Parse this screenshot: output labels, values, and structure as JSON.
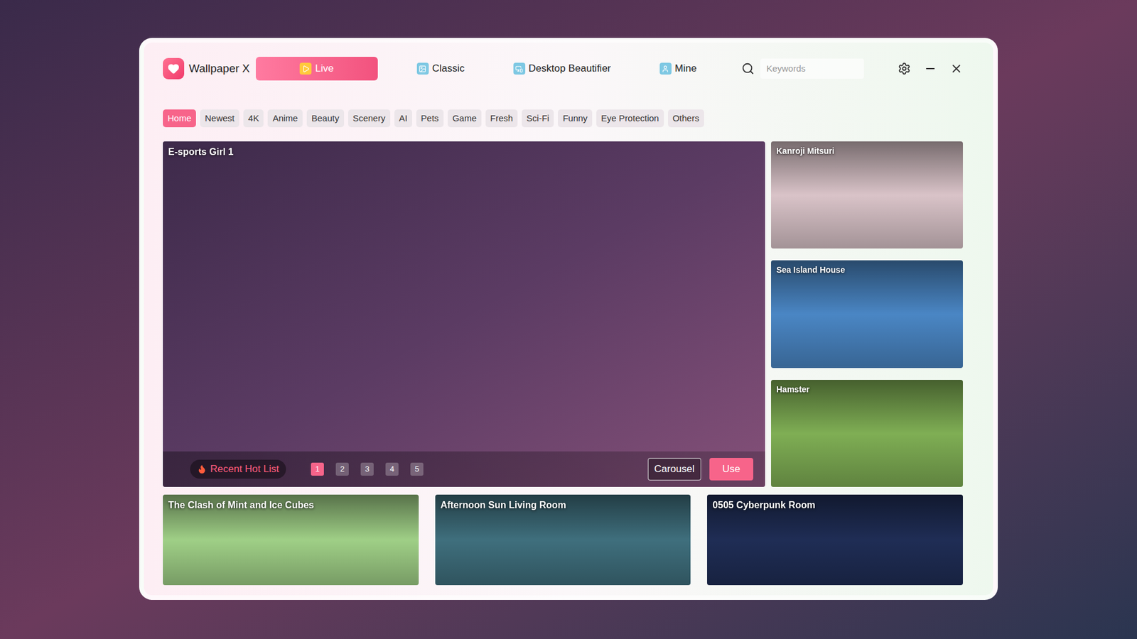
{
  "app": {
    "name": "Wallpaper X"
  },
  "nav_tabs": [
    {
      "label": "Live",
      "selected": true
    },
    {
      "label": "Classic",
      "selected": false
    },
    {
      "label": "Desktop Beautifier",
      "selected": false
    },
    {
      "label": "Mine",
      "selected": false
    }
  ],
  "search": {
    "placeholder": "Keywords"
  },
  "categories": [
    {
      "label": "Home",
      "selected": true
    },
    {
      "label": "Newest",
      "selected": false
    },
    {
      "label": "4K",
      "selected": false
    },
    {
      "label": "Anime",
      "selected": false
    },
    {
      "label": "Beauty",
      "selected": false
    },
    {
      "label": "Scenery",
      "selected": false
    },
    {
      "label": "AI",
      "selected": false
    },
    {
      "label": "Pets",
      "selected": false
    },
    {
      "label": "Game",
      "selected": false
    },
    {
      "label": "Fresh",
      "selected": false
    },
    {
      "label": "Sci-Fi",
      "selected": false
    },
    {
      "label": "Funny",
      "selected": false
    },
    {
      "label": "Eye Protection",
      "selected": false
    },
    {
      "label": "Others",
      "selected": false
    }
  ],
  "featured": {
    "title": "E-sports Girl 1",
    "color": "#5b3b63",
    "hot_list_label": "Recent Hot List",
    "pages": [
      {
        "label": "1",
        "selected": true
      },
      {
        "label": "2",
        "selected": false
      },
      {
        "label": "3",
        "selected": false
      },
      {
        "label": "4",
        "selected": false
      },
      {
        "label": "5",
        "selected": false
      }
    ],
    "buttons": [
      "Carousel",
      "Use"
    ]
  },
  "side_cards": [
    {
      "title": "Kanroji Mitsuri",
      "color": "#d9c3c8"
    },
    {
      "title": "Sea Island House",
      "color": "#4a86c4"
    },
    {
      "title": "Hamster",
      "color": "#7fae54"
    }
  ],
  "bottom_cards": [
    {
      "title": "The Clash of Mint and Ice Cubes",
      "color": "#9fcf86"
    },
    {
      "title": "Afternoon Sun Living Room",
      "color": "#3f6f7d"
    },
    {
      "title": "0505 Cyberpunk Room",
      "color": "#1f2d55"
    }
  ]
}
